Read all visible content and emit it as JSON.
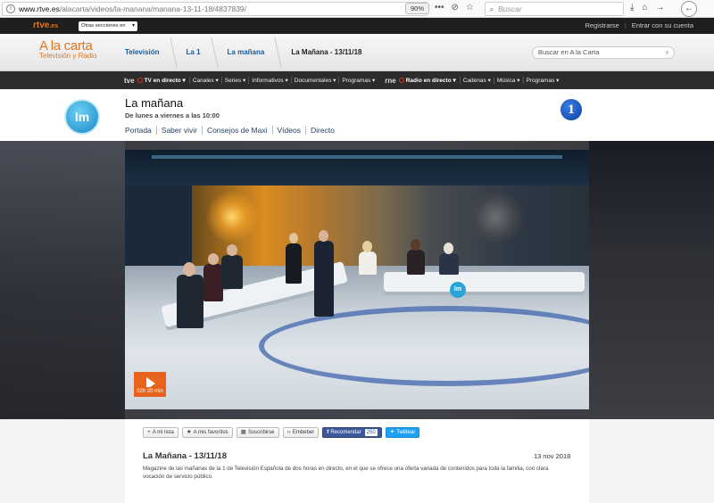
{
  "browser": {
    "url_domain": "www.rtve.es",
    "url_path": "/alacarta/videos/la-manana/manana-13-11-18/4837839/",
    "zoom": "90%",
    "search_placeholder": "Buscar"
  },
  "rtve_top": {
    "logo": "rtve",
    "logo_suffix": ".es",
    "otras_secciones": "Otras secciones en RTVE.es",
    "links": [
      "Registrarse",
      "Entrar con su cuenta"
    ]
  },
  "alacarta": {
    "title": "A la carta",
    "subtitle": "Televisión y Radio",
    "breadcrumbs": [
      "Televisión",
      "La 1",
      "La mañana",
      "La Mañana - 13/11/18"
    ],
    "search_placeholder": "Buscar en A la Carta"
  },
  "channels": {
    "tve_brand": "tve",
    "tve_live": "TV en directo",
    "tve_items": [
      "Canales",
      "Series",
      "Informativos",
      "Documentales",
      "Programas"
    ],
    "rne_brand": "rne",
    "rne_live": "Radio en directo",
    "rne_items": [
      "Cadenas",
      "Música",
      "Programas"
    ]
  },
  "program": {
    "logo_text": "lm",
    "title": "La mañana",
    "schedule": "De lunes a viernes a las 10:00",
    "nav": [
      "Portada",
      "Saber vivir",
      "Consejos de Maxi",
      "Vídeos",
      "Directo"
    ],
    "channel_badge": "1"
  },
  "video": {
    "duration": "02h 20 min",
    "set_logo": "lm"
  },
  "actions": {
    "my_list": "A mi lista",
    "favorites": "A mis favoritos",
    "subscribe": "Suscribirse",
    "embed": "Embeber",
    "facebook": "Recomendar",
    "facebook_count": "250",
    "twitter": "Twittear"
  },
  "episode": {
    "title": "La Mañana - 13/11/18",
    "date": "13 nov 2018",
    "description": "Magazine de las mañanas de la 1 de Televisión Española de dos horas en directo, en el que se ofrece una oferta variada de contenidos para toda la familia, con clara vocación de servicio público."
  },
  "colors": {
    "accent_orange": "#e07622",
    "link_blue": "#1a5b9c",
    "play_orange": "#e8641d"
  }
}
